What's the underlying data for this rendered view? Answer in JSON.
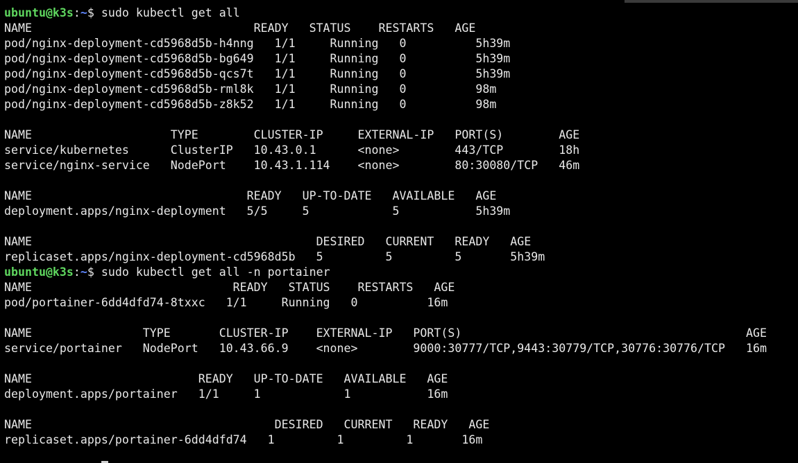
{
  "colors": {
    "background": "#000000",
    "text": "#e8e8e8",
    "prompt_user": "#5fd75f",
    "prompt_path": "#5f87ff"
  },
  "prompt": {
    "user_host": "ubuntu@k3s",
    "sep": ":",
    "path": "~",
    "symbol": "$ "
  },
  "terminal": {
    "lines": [
      {
        "type": "prompt",
        "cmd": "sudo kubectl get all"
      },
      {
        "type": "out",
        "text": "NAME                                READY   STATUS    RESTARTS   AGE"
      },
      {
        "type": "out",
        "text": "pod/nginx-deployment-cd5968d5b-h4nng   1/1     Running   0          5h39m"
      },
      {
        "type": "out",
        "text": "pod/nginx-deployment-cd5968d5b-bg649   1/1     Running   0          5h39m"
      },
      {
        "type": "out",
        "text": "pod/nginx-deployment-cd5968d5b-qcs7t   1/1     Running   0          5h39m"
      },
      {
        "type": "out",
        "text": "pod/nginx-deployment-cd5968d5b-rml8k   1/1     Running   0          98m"
      },
      {
        "type": "out",
        "text": "pod/nginx-deployment-cd5968d5b-z8k52   1/1     Running   0          98m"
      },
      {
        "type": "out",
        "text": ""
      },
      {
        "type": "out",
        "text": "NAME                    TYPE        CLUSTER-IP     EXTERNAL-IP   PORT(S)        AGE"
      },
      {
        "type": "out",
        "text": "service/kubernetes      ClusterIP   10.43.0.1      <none>        443/TCP        18h"
      },
      {
        "type": "out",
        "text": "service/nginx-service   NodePort    10.43.1.114    <none>        80:30080/TCP   46m"
      },
      {
        "type": "out",
        "text": ""
      },
      {
        "type": "out",
        "text": "NAME                               READY   UP-TO-DATE   AVAILABLE   AGE"
      },
      {
        "type": "out",
        "text": "deployment.apps/nginx-deployment   5/5     5            5           5h39m"
      },
      {
        "type": "out",
        "text": ""
      },
      {
        "type": "out",
        "text": "NAME                                         DESIRED   CURRENT   READY   AGE"
      },
      {
        "type": "out",
        "text": "replicaset.apps/nginx-deployment-cd5968d5b   5         5         5       5h39m"
      },
      {
        "type": "prompt",
        "cmd": "sudo kubectl get all -n portainer"
      },
      {
        "type": "out",
        "text": "NAME                             READY   STATUS    RESTARTS   AGE"
      },
      {
        "type": "out",
        "text": "pod/portainer-6dd4dfd74-8txxc   1/1     Running   0          16m"
      },
      {
        "type": "out",
        "text": ""
      },
      {
        "type": "out",
        "text": "NAME                TYPE       CLUSTER-IP    EXTERNAL-IP   PORT(S)                                         AGE"
      },
      {
        "type": "out",
        "text": "service/portainer   NodePort   10.43.66.9    <none>        9000:30777/TCP,9443:30779/TCP,30776:30776/TCP   16m"
      },
      {
        "type": "out",
        "text": ""
      },
      {
        "type": "out",
        "text": "NAME                        READY   UP-TO-DATE   AVAILABLE   AGE"
      },
      {
        "type": "out",
        "text": "deployment.apps/portainer   1/1     1            1           16m"
      },
      {
        "type": "out",
        "text": ""
      },
      {
        "type": "out",
        "text": "NAME                                   DESIRED   CURRENT   READY   AGE"
      },
      {
        "type": "out",
        "text": "replicaset.apps/portainer-6dd4dfd74   1         1         1       16m"
      },
      {
        "type": "cursor"
      }
    ]
  }
}
